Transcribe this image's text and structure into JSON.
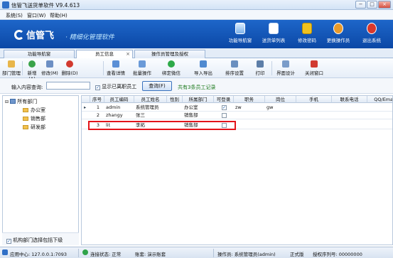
{
  "window": {
    "title": "信管飞送货单软件 V9.4.613",
    "controls": [
      "−",
      "□",
      "×"
    ]
  },
  "menu": [
    "系统(S)",
    "窗口(W)",
    "帮助(H)"
  ],
  "header": {
    "brand": "信管飞",
    "slogan": "· 精细化管理软件",
    "buttons": [
      {
        "label": "功能导航窗",
        "icon": "monitor-icon"
      },
      {
        "label": "送货单列表",
        "icon": "list-icon"
      },
      {
        "label": "修改密码",
        "icon": "lock-icon"
      },
      {
        "label": "更换操作员",
        "icon": "user-icon"
      },
      {
        "label": "退出系统",
        "icon": "exit-icon"
      }
    ]
  },
  "tabs": [
    {
      "label": "功能导航窗",
      "active": false
    },
    {
      "label": "员工信息",
      "active": true
    },
    {
      "label": "操作员管理及授权",
      "active": false
    }
  ],
  "toolbar": [
    {
      "label": "部门管理",
      "icon": "folder-icon",
      "color": "#e8b64a"
    },
    {
      "label": "新增(A)",
      "icon": "add-icon",
      "color": "#3aa34a"
    },
    {
      "label": "修改(M)",
      "icon": "edit-icon",
      "color": "#6c8fc4"
    },
    {
      "label": "删除(D)",
      "icon": "delete-icon",
      "color": "#d23a2f"
    },
    {
      "label": "查看详情",
      "icon": "details-icon",
      "color": "#5b8fd6"
    },
    {
      "label": "批量操作",
      "icon": "batch-icon",
      "color": "#6a9ad8"
    },
    {
      "label": "绑定微信",
      "icon": "wechat-icon",
      "color": "#2eaa49"
    },
    {
      "label": "导入导出",
      "icon": "import-export-icon",
      "color": "#4f8ad0"
    },
    {
      "label": "排序设置",
      "icon": "sort-icon",
      "color": "#6a8fbf"
    },
    {
      "label": "打印",
      "icon": "print-icon",
      "color": "#5d7ea8"
    },
    {
      "label": "界面设计",
      "icon": "design-icon",
      "color": "#7a9cc9"
    },
    {
      "label": "关闭窗口",
      "icon": "close-window-icon",
      "color": "#d13b31"
    }
  ],
  "search": {
    "label": "输入内容查询:",
    "value": "",
    "show_resigned_label": "显示已离职员工",
    "show_resigned_checked": true,
    "query_button": "查询(F)",
    "count_text": "共有3条员工记录"
  },
  "tree": {
    "root": "所有部门",
    "children": [
      "办公室",
      "销售部",
      "研发部"
    ],
    "footer_label": "机构部门选择包括下级",
    "footer_checked": true
  },
  "grid": {
    "columns": [
      "序号",
      "员工编码",
      "员工姓名",
      "性别",
      "所属部门",
      "可登录",
      "职务",
      "岗位",
      "手机",
      "联系电话",
      "QQ/Email"
    ],
    "rows": [
      {
        "cells": [
          "1",
          "admin",
          "系统管理员",
          "",
          "办公室",
          "",
          "zw",
          "gw",
          "",
          "",
          ""
        ],
        "can_login": true,
        "current": true
      },
      {
        "cells": [
          "2",
          "zhangy",
          "张三",
          "",
          "销售部",
          "",
          "",
          "",
          "",
          "",
          ""
        ],
        "can_login": false,
        "current": false
      },
      {
        "cells": [
          "3",
          "lit",
          "李拓",
          "",
          "销售部",
          "",
          "",
          "",
          "",
          "",
          ""
        ],
        "can_login": false,
        "current": false
      }
    ]
  },
  "status": {
    "app_center": "应用中心: 127.0.0.1:7093",
    "connection": "连接状态: 正常",
    "account": "账套: 演示账套",
    "operator": "操作员: 系统管理员(admin)",
    "edition": "正式版",
    "serial": "授权序列号: 00000000"
  },
  "colors": {
    "header": "#1a5fc2",
    "highlight": "#e3141a",
    "accent": "#1a5fb4"
  }
}
